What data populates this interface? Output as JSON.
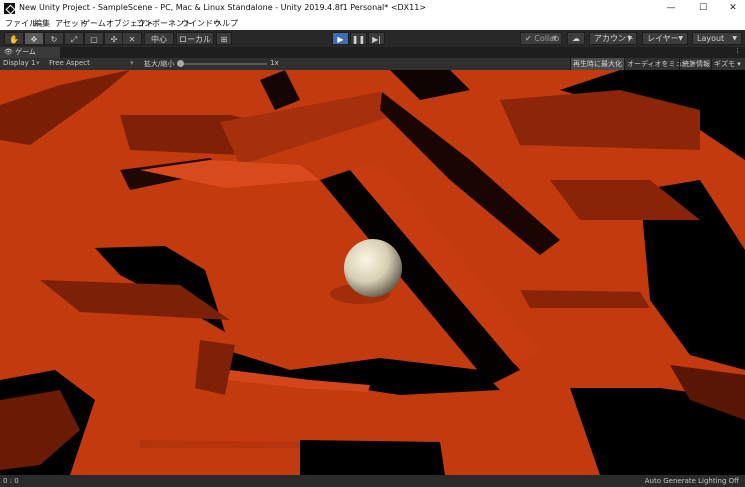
{
  "window": {
    "title": "New Unity Project - SampleScene - PC, Mac & Linux Standalone - Unity 2019.4.8f1 Personal* <DX11>",
    "minimize": "—",
    "maximize": "☐",
    "close": "✕"
  },
  "menu": [
    "ファイル",
    "編集",
    "アセット",
    "ゲームオブジェクト",
    "コンポーネント",
    "ウインドウ",
    "ヘルプ"
  ],
  "toolbar": {
    "tools": [
      "hand-icon",
      "move-icon",
      "rotate-icon",
      "scale-icon",
      "rect-icon",
      "transform-icon"
    ],
    "pivot_label": "中心",
    "space_label": "ローカル",
    "collab_label": "Collab",
    "account_label": "アカウント",
    "layers_label": "レイヤー",
    "layout_label": "Layout"
  },
  "game_tab": {
    "label": "ゲーム"
  },
  "game_bar": {
    "display": "Display 1",
    "aspect": "Free Aspect",
    "scale_label": "拡大/縮小",
    "scale_value": "1x",
    "maximize_on_play": "再生時に最大化",
    "mute_audio": "オーディオをミュート",
    "stats": "統計情報",
    "gizmos": "ギズモ"
  },
  "status": {
    "left": "0 : 0",
    "right": "Auto Generate Lighting Off"
  },
  "colors": {
    "floor": "#c23a0e",
    "wall_top": "#d8481a",
    "wall_shadow": "#6a1a05",
    "void": "#000000",
    "play_active": "#3c6fb4"
  }
}
